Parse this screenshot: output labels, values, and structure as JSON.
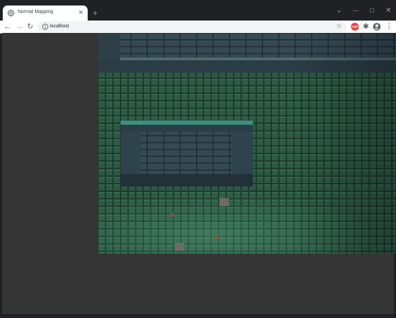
{
  "tab": {
    "title": "Normal Mapping",
    "close_icon": "close-icon"
  },
  "toolbar": {
    "url": "localhost"
  },
  "icons": {
    "favicon": "globe-icon",
    "new_tab": "plus-icon",
    "back": "arrow-left-icon",
    "forward": "arrow-right-icon",
    "reload": "reload-icon",
    "site_info": "info-icon",
    "bookmark": "star-icon",
    "extension_1": "adblock-icon",
    "extension_2": "puzzle-icon",
    "profile": "avatar-icon",
    "menu": "kebab-menu-icon"
  },
  "colors": {
    "chrome_dark": "#202124",
    "page_background": "#353535",
    "extension_red": "#e8403b"
  },
  "glyphs": {
    "close": "✕",
    "new_tab": "+",
    "tab_search": "⌄",
    "minimize": "—",
    "maximize": "□",
    "close_window": "✕",
    "back": "←",
    "forward": "→",
    "reload": "↻",
    "bookmark": "☆",
    "extensions": "✱",
    "menu": "⋮"
  },
  "extension_badge": "ABP"
}
